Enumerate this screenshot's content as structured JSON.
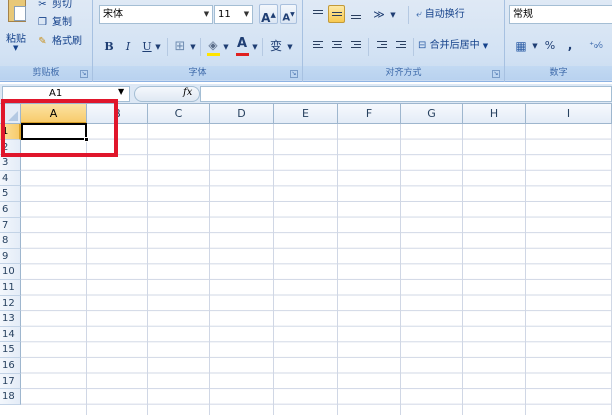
{
  "ribbon": {
    "clipboard": {
      "paste_label": "粘贴",
      "cut_label": "剪切",
      "copy_label": "复制",
      "format_painter_label": "格式刷",
      "group_label": "剪贴板"
    },
    "font": {
      "font_name": "宋体",
      "font_size": "11",
      "grow_label": "A",
      "shrink_label": "A",
      "bold_label": "B",
      "italic_label": "I",
      "underline_label": "U",
      "font_color_label": "A",
      "phonetic_label": "变",
      "group_label": "字体"
    },
    "alignment": {
      "wrap_text_label": "自动换行",
      "merge_center_label": "合并后居中",
      "group_label": "对齐方式"
    },
    "number": {
      "format_value": "常规",
      "percent_label": "%",
      "comma_label": ",",
      "group_label": "数字"
    }
  },
  "formula_bar": {
    "name_box": "A1",
    "fx_label": "fx",
    "formula": ""
  },
  "grid": {
    "columns": [
      "A",
      "B",
      "C",
      "D",
      "E",
      "F",
      "G",
      "H",
      "I"
    ],
    "rows": [
      "1",
      "2",
      "3",
      "4",
      "5",
      "6",
      "7",
      "8",
      "9",
      "10",
      "11",
      "12",
      "13",
      "14",
      "15",
      "16",
      "17",
      "18"
    ],
    "selected_cell": "A1"
  },
  "colors": {
    "highlight": "#e0162b",
    "ribbon_bg": "#d4e3f4",
    "selected_header": "#f8cb6c",
    "gridline": "#d0d7e5"
  }
}
